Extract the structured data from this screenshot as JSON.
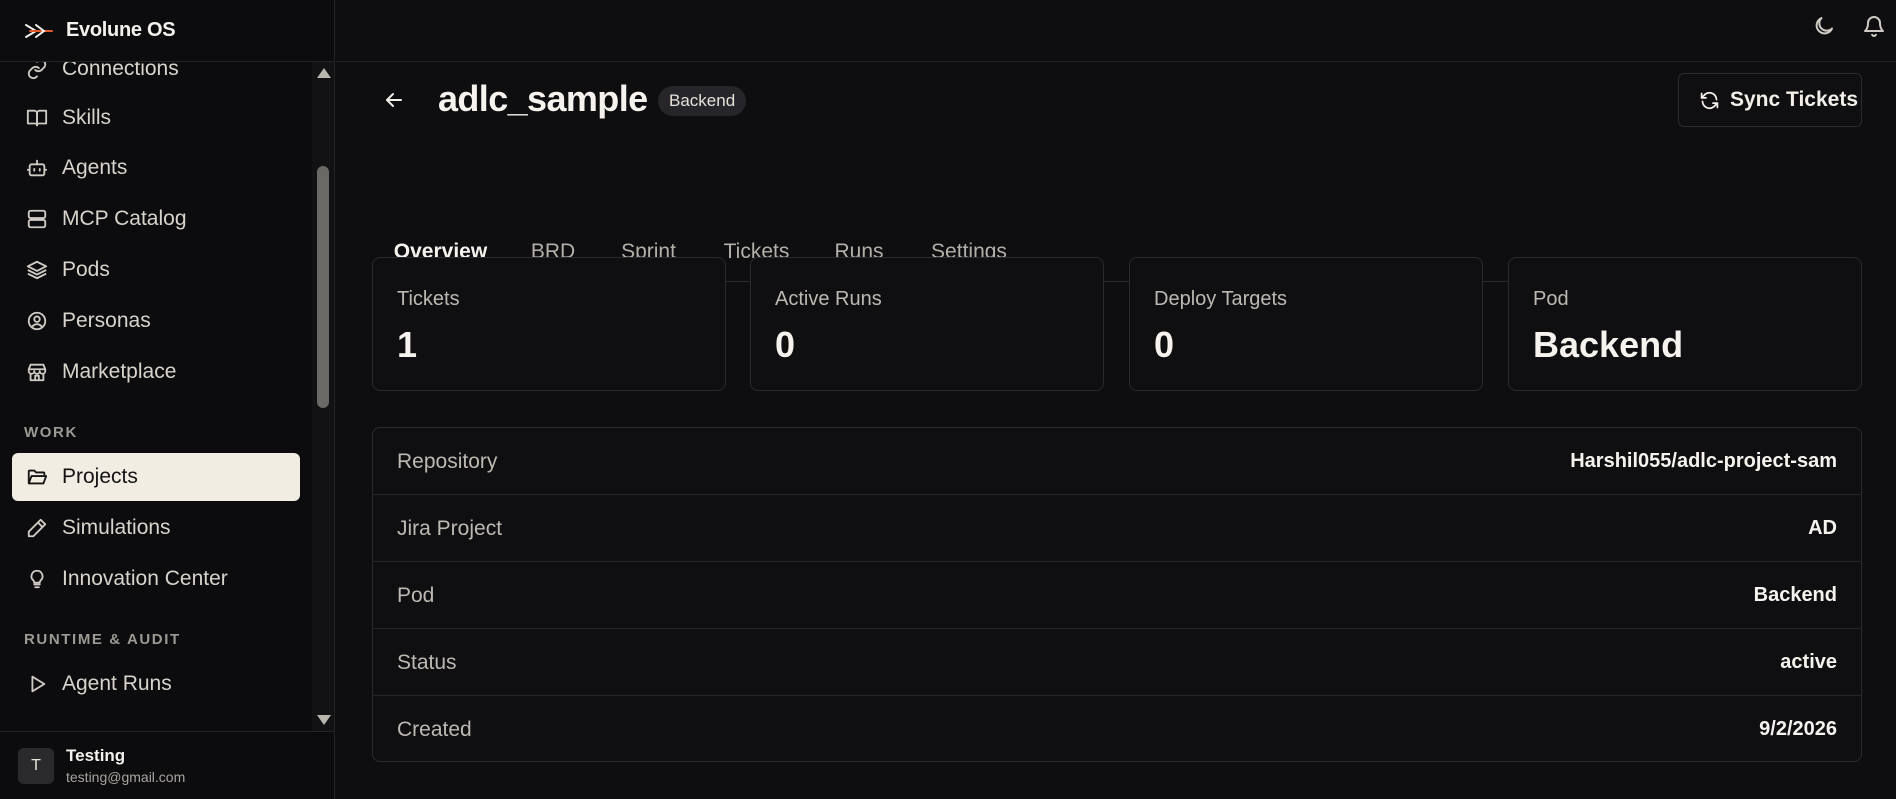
{
  "app": {
    "name": "Evolune OS"
  },
  "sidebar": {
    "items": [
      {
        "label": "Connections",
        "icon": "link-icon"
      },
      {
        "label": "Skills",
        "icon": "book-icon"
      },
      {
        "label": "Agents",
        "icon": "bot-icon"
      },
      {
        "label": "MCP Catalog",
        "icon": "server-icon"
      },
      {
        "label": "Pods",
        "icon": "layers-icon"
      },
      {
        "label": "Personas",
        "icon": "user-circle-icon"
      },
      {
        "label": "Marketplace",
        "icon": "store-icon"
      }
    ],
    "work_label": "WORK",
    "work_items": [
      {
        "label": "Projects",
        "icon": "folder-open-icon",
        "active": true
      },
      {
        "label": "Simulations",
        "icon": "pencil-icon"
      },
      {
        "label": "Innovation Center",
        "icon": "lightbulb-icon"
      }
    ],
    "runtime_label": "RUNTIME & AUDIT",
    "runtime_items": [
      {
        "label": "Agent Runs",
        "icon": "play-icon"
      }
    ]
  },
  "user": {
    "initial": "T",
    "name": "Testing",
    "email": "testing@gmail.com"
  },
  "project": {
    "name": "adlc_sample",
    "tag": "Backend",
    "sync_label": "Sync Tickets"
  },
  "tabs": [
    {
      "label": "Overview",
      "active": true
    },
    {
      "label": "BRD"
    },
    {
      "label": "Sprint"
    },
    {
      "label": "Tickets"
    },
    {
      "label": "Runs"
    },
    {
      "label": "Settings"
    }
  ],
  "stats": [
    {
      "label": "Tickets",
      "value": "1"
    },
    {
      "label": "Active Runs",
      "value": "0"
    },
    {
      "label": "Deploy Targets",
      "value": "0"
    },
    {
      "label": "Pod",
      "value": "Backend"
    }
  ],
  "details": [
    {
      "label": "Repository",
      "value": "Harshil055/adlc-project-sam"
    },
    {
      "label": "Jira Project",
      "value": "AD"
    },
    {
      "label": "Pod",
      "value": "Backend"
    },
    {
      "label": "Status",
      "value": "active"
    },
    {
      "label": "Created",
      "value": "9/2/2026"
    }
  ]
}
